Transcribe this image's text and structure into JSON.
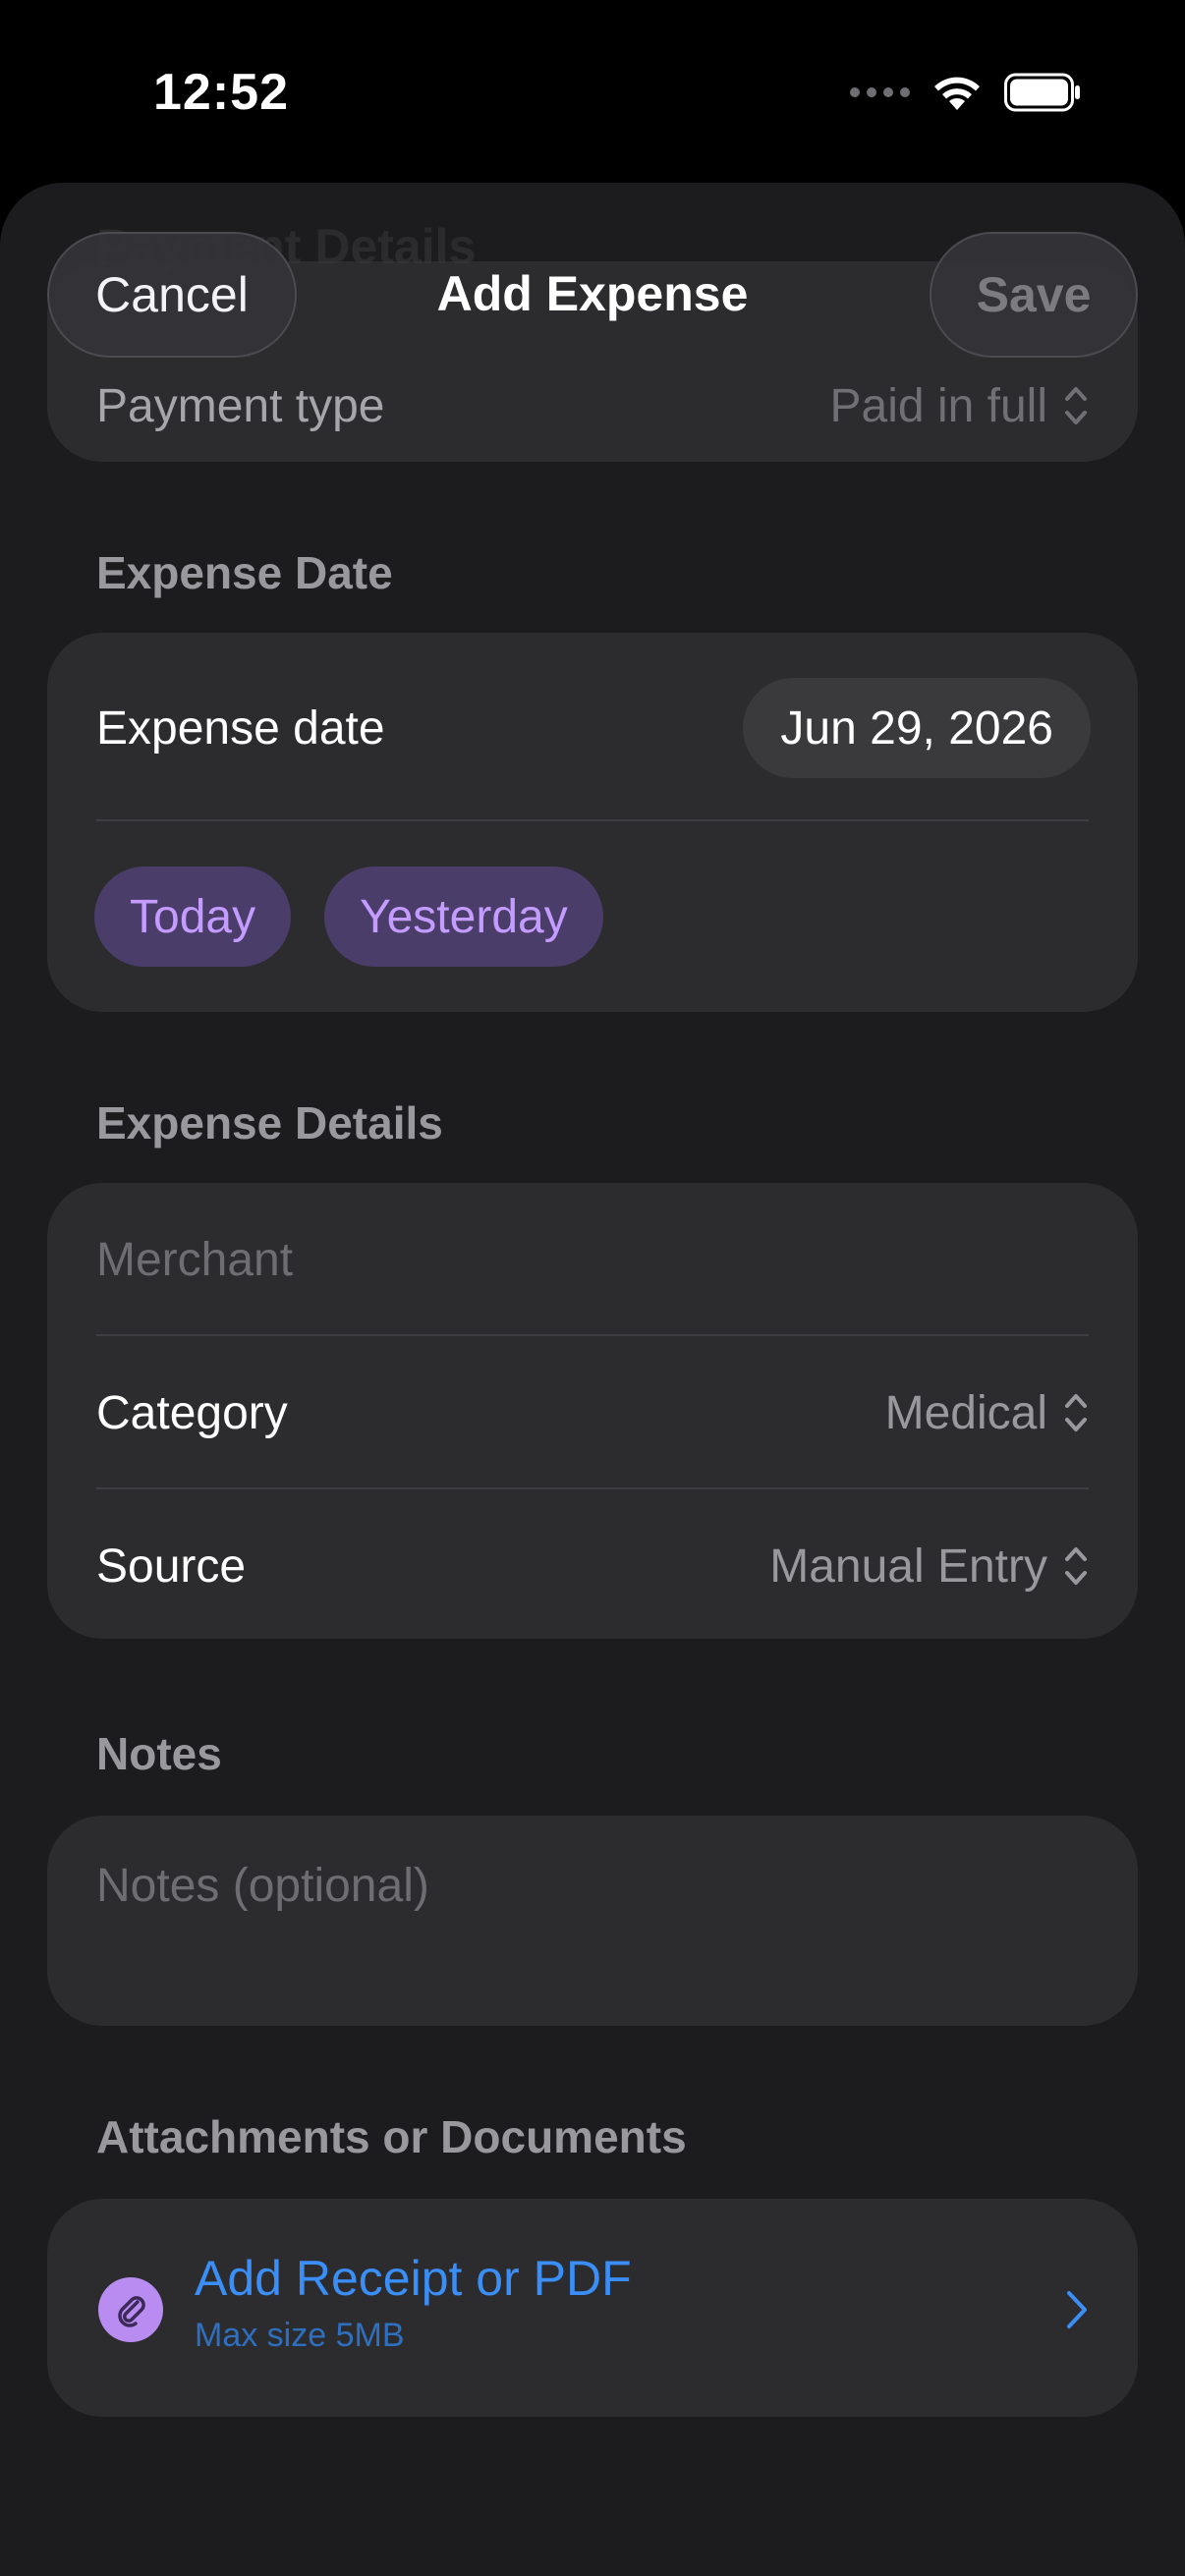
{
  "status_bar": {
    "time": "12:52"
  },
  "nav": {
    "title": "Add Expense",
    "cancel_label": "Cancel",
    "save_label": "Save",
    "scrolled_header_ghost": "Payment Details"
  },
  "payment": {
    "type_label": "Payment type",
    "type_value": "Paid in full"
  },
  "expense_date": {
    "section_title": "Expense Date",
    "label": "Expense date",
    "value": "Jun 29, 2026",
    "quick_options": [
      "Today",
      "Yesterday"
    ]
  },
  "expense_details": {
    "section_title": "Expense Details",
    "merchant_placeholder": "Merchant",
    "category_label": "Category",
    "category_value": "Medical",
    "source_label": "Source",
    "source_value": "Manual Entry"
  },
  "notes": {
    "section_title": "Notes",
    "placeholder": "Notes (optional)"
  },
  "attachments": {
    "section_title": "Attachments or Documents",
    "add_label": "Add Receipt or PDF",
    "max_size": "Max size 5MB"
  },
  "colors": {
    "accent_purple": "#c49bff",
    "link_blue": "#3a8ef6",
    "card_bg": "#2c2c2e",
    "sheet_bg": "#1c1c1e"
  }
}
